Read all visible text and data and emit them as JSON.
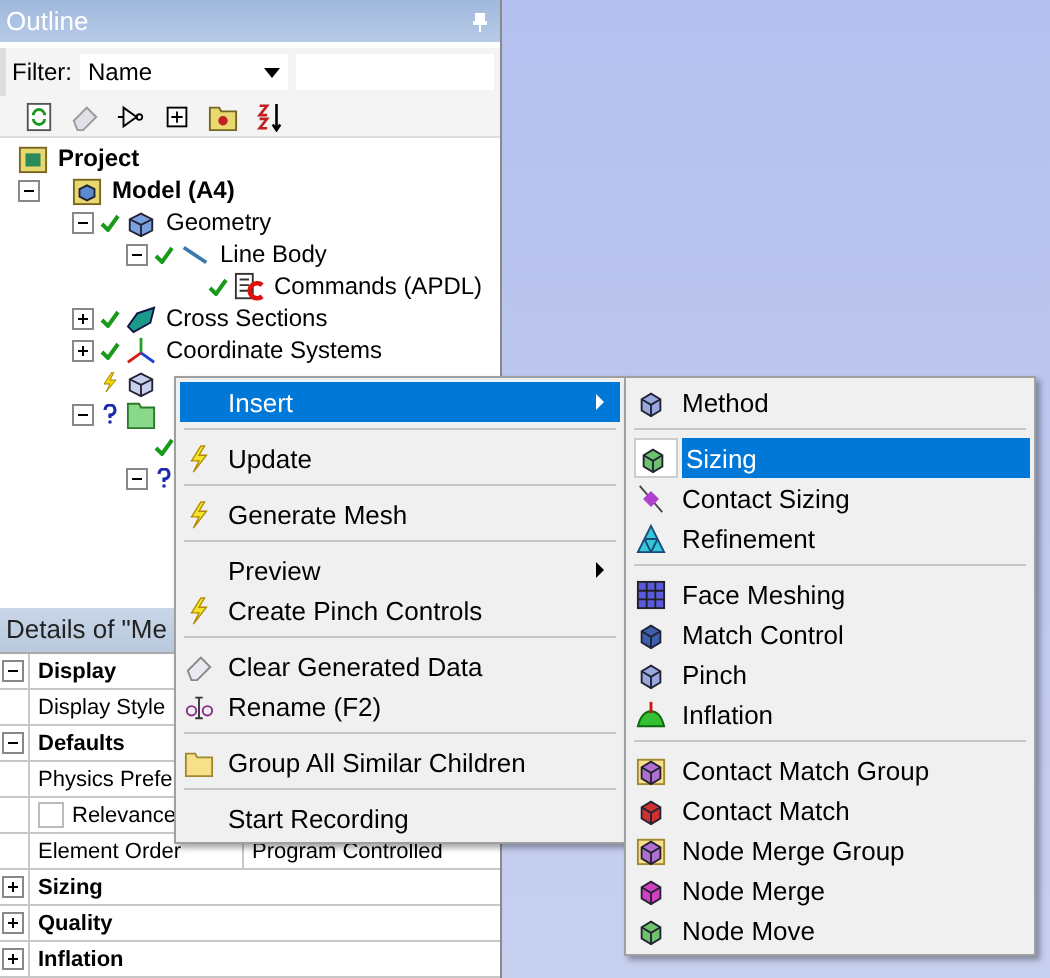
{
  "outline": {
    "title": "Outline",
    "filter": {
      "label": "Filter:",
      "value": "Name"
    },
    "tree": [
      {
        "label": "Project",
        "kind": "project",
        "bold": true,
        "children": [
          {
            "label": "Model (A4)",
            "kind": "model",
            "solved": false,
            "outdated": false,
            "unresolved": false,
            "bold": true,
            "expanded": true,
            "children": [
              {
                "label": "Geometry",
                "kind": "geometry",
                "solved": true,
                "outdated": false,
                "unresolved": false,
                "bold": false,
                "expanded": true,
                "children": [
                  {
                    "label": "Line Body",
                    "kind": "line",
                    "solved": true,
                    "outdated": false,
                    "unresolved": false,
                    "bold": false,
                    "expanded": true,
                    "children": [
                      {
                        "label": "Commands (APDL)",
                        "kind": "commands",
                        "solved": true,
                        "outdated": false,
                        "unresolved": false,
                        "bold": false
                      }
                    ]
                  }
                ]
              },
              {
                "label": "Cross Sections",
                "kind": "cross",
                "solved": true,
                "outdated": false,
                "unresolved": false,
                "bold": false,
                "expanded": false
              },
              {
                "label": "Coordinate Systems",
                "kind": "coords",
                "solved": true,
                "outdated": false,
                "unresolved": false,
                "bold": false,
                "expanded": false
              },
              {
                "kind": "mesh",
                "solved": false,
                "outdated": true,
                "unresolved": false
              },
              {
                "kind": "folder",
                "solved": false,
                "outdated": false,
                "unresolved": true,
                "expanded": true,
                "children": [
                  {
                    "kind": "blank",
                    "solved": true,
                    "outdated": false,
                    "unresolved": false
                  },
                  {
                    "kind": "blank",
                    "solved": false,
                    "outdated": false,
                    "unresolved": true,
                    "expanded": true
                  }
                ]
              }
            ]
          }
        ]
      }
    ]
  },
  "details": {
    "title": "Details of \"Me",
    "rows": [
      {
        "kind": "group",
        "label": "Display",
        "expanded": true
      },
      {
        "kind": "prop",
        "label": "Display Style"
      },
      {
        "kind": "group",
        "label": "Defaults",
        "expanded": true
      },
      {
        "kind": "prop",
        "label": "Physics Prefe"
      },
      {
        "kind": "check",
        "label": "Relevance",
        "checked": false
      },
      {
        "kind": "prop",
        "label": "Element Order",
        "value": "Program Controlled"
      },
      {
        "kind": "group",
        "label": "Sizing",
        "expanded": false
      },
      {
        "kind": "group",
        "label": "Quality",
        "expanded": false
      },
      {
        "kind": "group",
        "label": "Inflation",
        "expanded": false
      }
    ]
  },
  "context_menu": [
    {
      "kind": "plain",
      "label": "Insert",
      "submenu": true,
      "selected": true
    },
    {
      "kind": "separator"
    },
    {
      "kind": "lightning",
      "label": "Update",
      "submenu": false,
      "selected": false
    },
    {
      "kind": "separator"
    },
    {
      "kind": "lightning",
      "label": "Generate Mesh",
      "submenu": false,
      "selected": false
    },
    {
      "kind": "separator"
    },
    {
      "kind": "plain",
      "label": "Preview",
      "submenu": true,
      "selected": false
    },
    {
      "kind": "lightning",
      "label": "Create Pinch Controls",
      "submenu": false,
      "selected": false
    },
    {
      "kind": "separator"
    },
    {
      "kind": "eraser",
      "label": "Clear Generated Data",
      "submenu": false,
      "selected": false
    },
    {
      "kind": "rename",
      "label": "Rename (F2)",
      "submenu": false,
      "selected": false
    },
    {
      "kind": "separator"
    },
    {
      "kind": "folder",
      "label": "Group All Similar Children",
      "submenu": false,
      "selected": false
    },
    {
      "kind": "separator"
    },
    {
      "kind": "plain",
      "label": "Start Recording",
      "submenu": false,
      "selected": false
    }
  ],
  "insert_submenu": [
    {
      "kind": "cube",
      "label": "Method",
      "selected": false
    },
    {
      "kind": "separator"
    },
    {
      "kind": "cube-green",
      "label": "Sizing",
      "selected": true
    },
    {
      "kind": "contact",
      "label": "Contact Sizing",
      "selected": false
    },
    {
      "kind": "triangle",
      "label": "Refinement",
      "selected": false
    },
    {
      "kind": "separator"
    },
    {
      "kind": "grid",
      "label": "Face Meshing",
      "selected": false
    },
    {
      "kind": "cube-dark",
      "label": "Match Control",
      "selected": false
    },
    {
      "kind": "cube",
      "label": "Pinch",
      "selected": false
    },
    {
      "kind": "inflation",
      "label": "Inflation",
      "selected": false
    },
    {
      "kind": "separator"
    },
    {
      "kind": "folder-cube",
      "label": "Contact Match Group",
      "selected": false
    },
    {
      "kind": "cube-red",
      "label": "Contact Match",
      "selected": false
    },
    {
      "kind": "folder-cube",
      "label": "Node Merge Group",
      "selected": false
    },
    {
      "kind": "cube-pink",
      "label": "Node Merge",
      "selected": false
    },
    {
      "kind": "cube-green",
      "label": "Node Move",
      "selected": false
    }
  ]
}
